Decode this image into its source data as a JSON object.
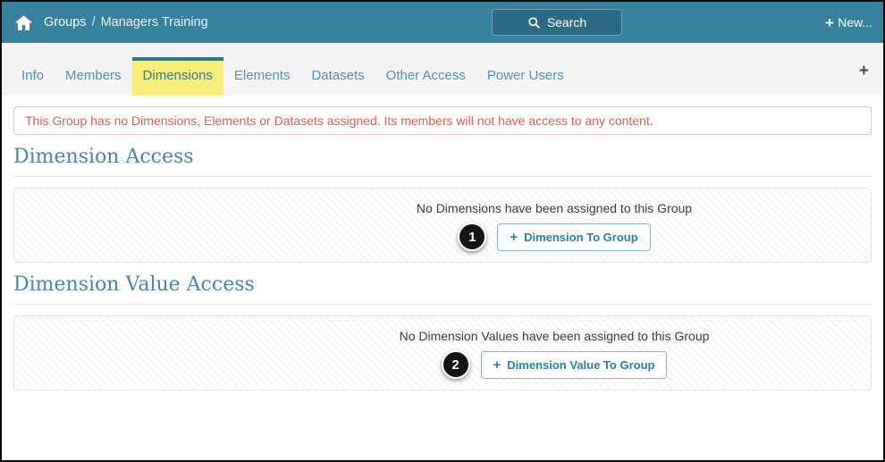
{
  "header": {
    "breadcrumb": {
      "section": "Groups",
      "separator": "/",
      "page": "Managers Training"
    },
    "search": {
      "label": "Search"
    },
    "new_button": {
      "icon": "+",
      "label": "New..."
    }
  },
  "tabs": {
    "items": [
      {
        "label": "Info",
        "active": false
      },
      {
        "label": "Members",
        "active": false
      },
      {
        "label": "Dimensions",
        "active": true
      },
      {
        "label": "Elements",
        "active": false
      },
      {
        "label": "Datasets",
        "active": false
      },
      {
        "label": "Other Access",
        "active": false
      },
      {
        "label": "Power Users",
        "active": false
      }
    ],
    "add_tab_icon": "+"
  },
  "alert": {
    "message": "This Group has no Dimensions, Elements or Datasets assigned. Its members will not have access to any content."
  },
  "sections": [
    {
      "title": "Dimension Access",
      "empty_message": "No Dimensions have been assigned to this Group",
      "callout_number": "1",
      "button": {
        "icon": "+",
        "label": "Dimension To Group"
      }
    },
    {
      "title": "Dimension Value Access",
      "empty_message": "No Dimension Values have been assigned to this Group",
      "callout_number": "2",
      "button": {
        "icon": "+",
        "label": "Dimension Value To Group"
      }
    }
  ],
  "colors": {
    "header_bg": "#37809e",
    "search_button_bg": "#2c6a83",
    "active_tab_bg": "#f6ef7d",
    "active_tab_border": "#2f7492",
    "tab_text": "#5591b5",
    "alert_text": "#dd5c5c",
    "heading_text": "#4d84aa",
    "button_accent": "#2e7fa6",
    "callout_bg": "#141414"
  }
}
